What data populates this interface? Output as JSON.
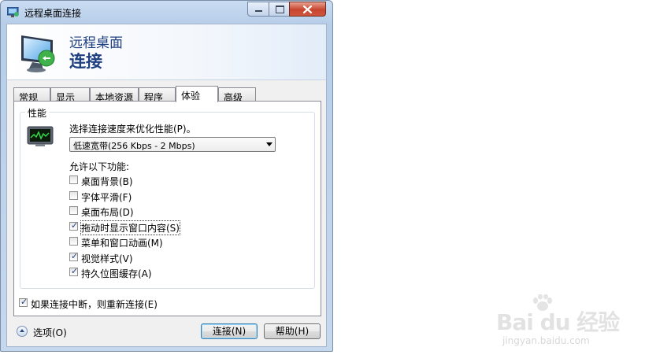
{
  "window": {
    "title": "远程桌面连接",
    "banner_line1": "远程桌面",
    "banner_line2": "连接",
    "icons": [
      "remote-desktop-app-icon",
      "monitor-icon",
      "minimize-icon",
      "maximize-icon",
      "close-icon"
    ]
  },
  "tabs": [
    {
      "label": "常规",
      "active": false
    },
    {
      "label": "显示",
      "active": false
    },
    {
      "label": "本地资源",
      "active": false
    },
    {
      "label": "程序",
      "active": false
    },
    {
      "label": "体验",
      "active": true
    },
    {
      "label": "高级",
      "active": false
    }
  ],
  "performance": {
    "group_label": "性能",
    "speed_label": "选择连接速度来优化性能(P)。",
    "speed_value": "低速宽带(256 Kbps - 2 Mbps)",
    "allow_label": "允许以下功能:",
    "options": [
      {
        "label": "桌面背景(B)",
        "checked": false
      },
      {
        "label": "字体平滑(F)",
        "checked": false
      },
      {
        "label": "桌面布局(D)",
        "checked": false
      },
      {
        "label": "拖动时显示窗口内容(S)",
        "checked": true,
        "focused": true
      },
      {
        "label": "菜单和窗口动画(M)",
        "checked": false
      },
      {
        "label": "视觉样式(V)",
        "checked": true
      },
      {
        "label": "持久位图缓存(A)",
        "checked": true
      }
    ]
  },
  "reconnect": {
    "label": "如果连接中断，则重新连接(E)",
    "checked": true
  },
  "footer": {
    "options_label": "选项(O)",
    "connect_label": "连接(N)",
    "help_label": "帮助(H)"
  },
  "watermark": {
    "main": "Bai du 经验",
    "sub": "jingyan.baidu.com"
  },
  "colors": {
    "banner_text": "#1e3f80",
    "close_button": "#c8452e",
    "checkmark": "#1f3f7f"
  }
}
